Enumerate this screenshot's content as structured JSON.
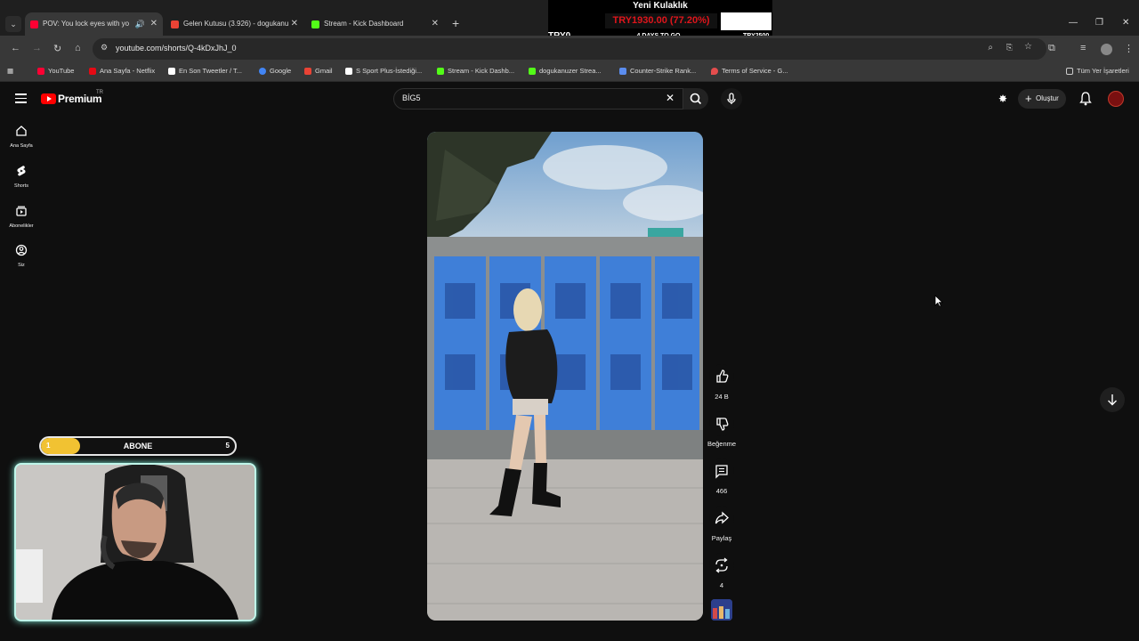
{
  "browser": {
    "tabs": [
      {
        "title": "POV: You lock eyes with yo",
        "active": true,
        "favicon_color": "#ff0033",
        "has_audio": true
      },
      {
        "title": "Gelen Kutusu (3.926) - dogukanu",
        "active": false,
        "favicon_color": "#ea4335"
      },
      {
        "title": "Stream - Kick Dashboard",
        "active": false,
        "favicon_color": "#53fc18"
      }
    ],
    "new_tab": "+",
    "url": "youtube.com/shorts/Q-4kDxJhJ_0",
    "bookmarks": [
      {
        "label": "YouTube",
        "color": "#ff0033"
      },
      {
        "label": "Ana Sayfa - Netflix",
        "color": "#e50914"
      },
      {
        "label": "En Son Tweetler / T...",
        "color": "#ffffff"
      },
      {
        "label": "Google",
        "color": "#4285f4"
      },
      {
        "label": "Gmail",
        "color": "#ea4335"
      },
      {
        "label": "S Sport Plus-İstediği...",
        "color": "#ffffff"
      },
      {
        "label": "Stream - Kick Dashb...",
        "color": "#53fc18"
      },
      {
        "label": "dogukanuzer Strea...",
        "color": "#53fc18"
      },
      {
        "label": "Counter-Strike Rank...",
        "color": "#5b8def"
      },
      {
        "label": "Terms of Service - G...",
        "color": "#e44d4d"
      }
    ],
    "all_bookmarks": "Tüm Yer İşaretleri"
  },
  "overlay": {
    "goal_title": "Yeni Kulaklık",
    "goal_amount": "TRY1930.00 (77.20%)",
    "goal_start": "TRY0",
    "goal_days": "4 DAYS TO GO",
    "goal_target": "TRY2500",
    "abone_label": "ABONE",
    "abone_current": "1",
    "abone_target": "5",
    "abone_progress": 0.2
  },
  "youtube": {
    "logo": "Premium",
    "logo_region": "TR",
    "search_value": "BİG5",
    "create_label": "Oluştur",
    "sidebar": [
      {
        "label": "Ana Sayfa",
        "icon": "home-icon"
      },
      {
        "label": "Shorts",
        "icon": "shorts-icon"
      },
      {
        "label": "Abonelikler",
        "icon": "subscriptions-icon"
      },
      {
        "label": "Siz",
        "icon": "you-icon"
      }
    ],
    "actions": {
      "likes": "24 B",
      "dislike": "Beğenme",
      "comments": "466",
      "share": "Paylaş",
      "remix": "4"
    }
  },
  "colors": {
    "accent": "#ff0000",
    "goal_red": "#e0151b",
    "abone_yellow": "#f1c232",
    "cam_border": "#bff6ea"
  }
}
